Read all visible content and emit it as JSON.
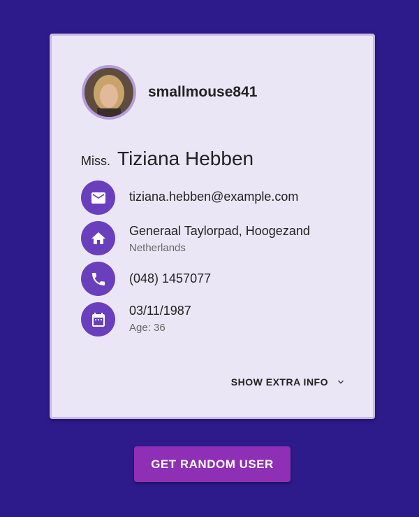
{
  "profile": {
    "username": "smallmouse841",
    "title": "Miss.",
    "full_name": "Tiziana Hebben",
    "avatar_icon": "user-photo"
  },
  "details": {
    "email": {
      "icon": "email-icon",
      "value": "tiziana.hebben@example.com"
    },
    "address": {
      "icon": "home-icon",
      "street": "Generaal Taylorpad, Hoogezand",
      "country": "Netherlands"
    },
    "phone": {
      "icon": "phone-icon",
      "value": "(048) 1457077"
    },
    "birthday": {
      "icon": "calendar-icon",
      "date": "03/11/1987",
      "age": "Age: 36"
    }
  },
  "actions": {
    "show_extra_label": "SHOW EXTRA INFO",
    "random_user_label": "GET RANDOM USER"
  },
  "colors": {
    "background": "#2d1b8c",
    "card": "#ebe6f5",
    "icon_circle": "#6a3fbd",
    "button": "#8e2fb5"
  }
}
